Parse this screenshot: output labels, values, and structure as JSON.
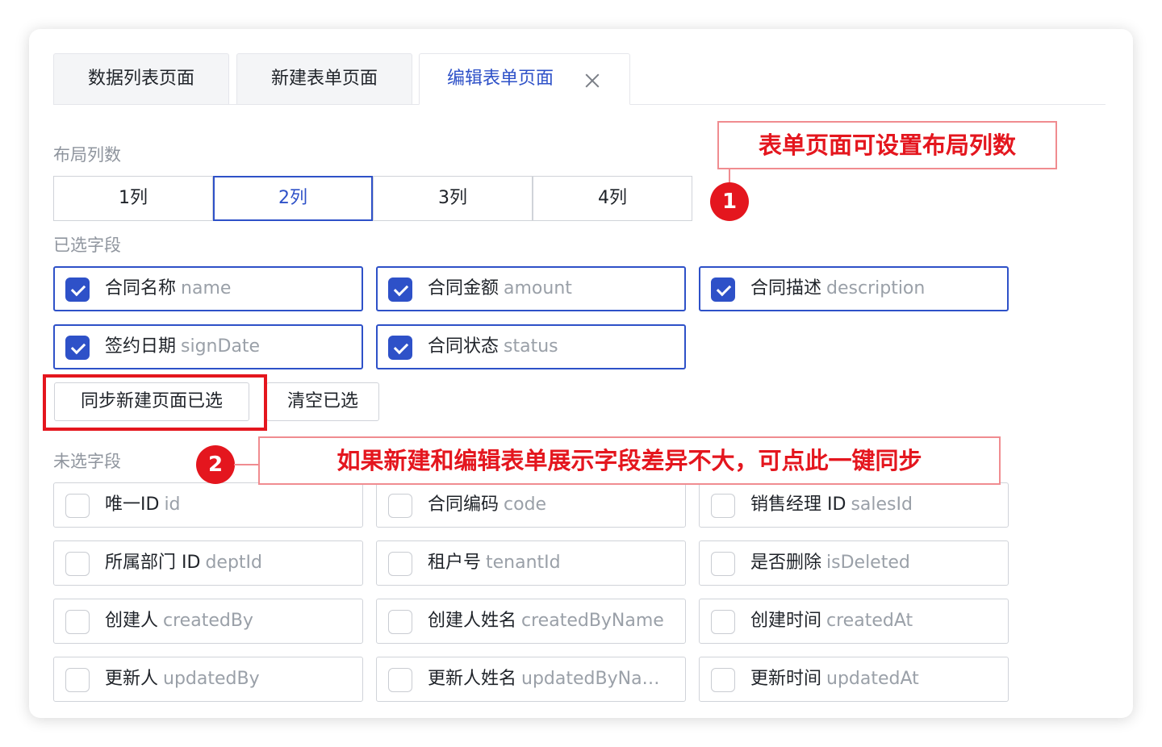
{
  "tabs": [
    {
      "label": "数据列表页面"
    },
    {
      "label": "新建表单页面"
    },
    {
      "label": "编辑表单页面"
    }
  ],
  "layout_section": {
    "label": "布局列数",
    "options": [
      "1列",
      "2列",
      "3列",
      "4列"
    ],
    "selected": "2列"
  },
  "selected_section": {
    "label": "已选字段",
    "fields": [
      {
        "name": "合同名称",
        "key": "name",
        "checked": true
      },
      {
        "name": "合同金额",
        "key": "amount",
        "checked": true
      },
      {
        "name": "合同描述",
        "key": "description",
        "checked": true
      },
      {
        "name": "签约日期",
        "key": "signDate",
        "checked": true
      },
      {
        "name": "合同状态",
        "key": "status",
        "checked": true
      }
    ]
  },
  "actions": {
    "sync_label": "同步新建页面已选",
    "clear_label": "清空已选"
  },
  "unselected_section": {
    "label": "未选字段",
    "fields": [
      {
        "name": "唯一ID",
        "key": "id",
        "checked": false
      },
      {
        "name": "合同编码",
        "key": "code",
        "checked": false
      },
      {
        "name": "销售经理 ID",
        "key": "salesId",
        "checked": false
      },
      {
        "name": "所属部门 ID",
        "key": "deptId",
        "checked": false
      },
      {
        "name": "租户号",
        "key": "tenantId",
        "checked": false
      },
      {
        "name": "是否删除",
        "key": "isDeleted",
        "checked": false
      },
      {
        "name": "创建人",
        "key": "createdBy",
        "checked": false
      },
      {
        "name": "创建人姓名",
        "key": "createdByName",
        "checked": false
      },
      {
        "name": "创建时间",
        "key": "createdAt",
        "checked": false
      },
      {
        "name": "更新人",
        "key": "updatedBy",
        "checked": false
      },
      {
        "name": "更新人姓名",
        "key": "updatedByNa…",
        "checked": false
      },
      {
        "name": "更新时间",
        "key": "updatedAt",
        "checked": false
      }
    ]
  },
  "annotations": {
    "callout_1": "表单页面可设置布局列数",
    "badge_1": "1",
    "callout_2": "如果新建和编辑表单展示字段差异不大，可点此一键同步",
    "badge_2": "2"
  },
  "colors": {
    "accent": "#2e51c8",
    "annotation_red": "#e4161e",
    "muted_text": "#9aa0a8"
  }
}
